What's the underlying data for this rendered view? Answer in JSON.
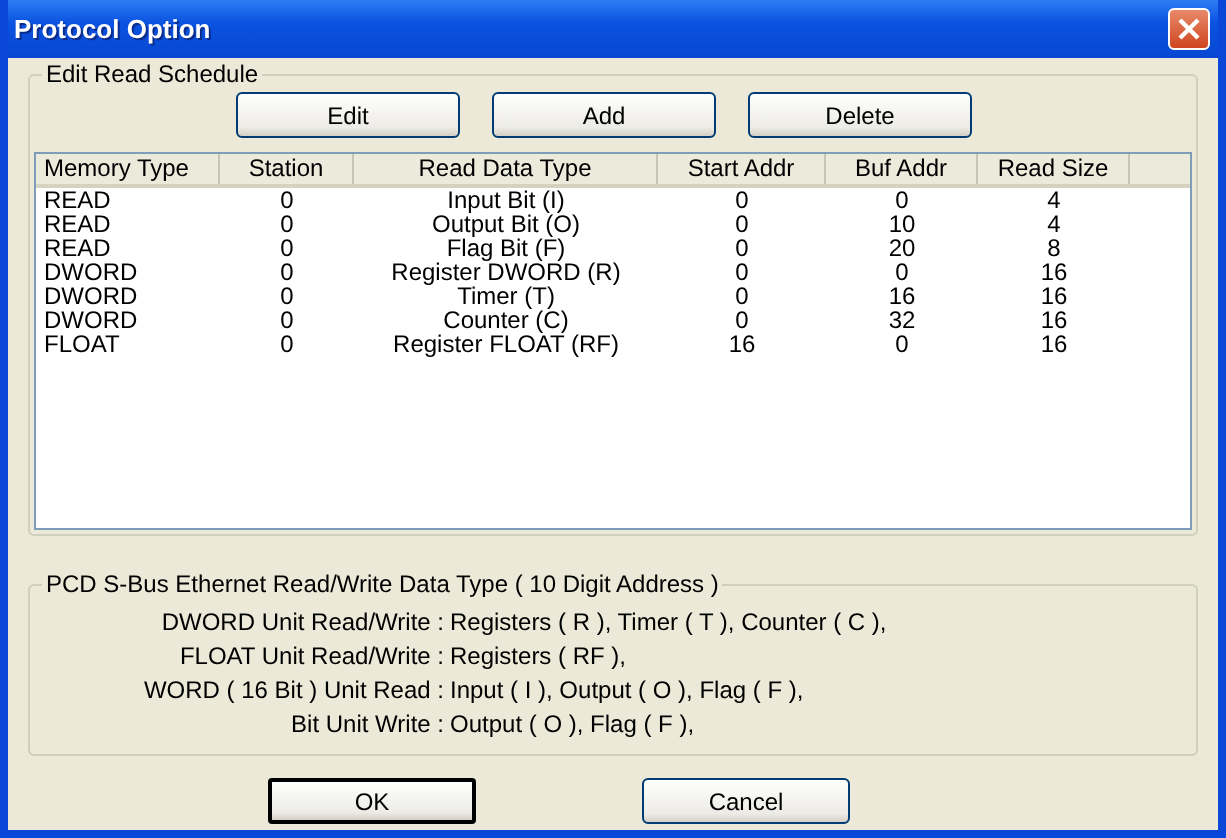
{
  "window": {
    "title": "Protocol Option"
  },
  "schedule": {
    "legend": "Edit Read Schedule",
    "buttons": [
      "Edit",
      "Add",
      "Delete"
    ],
    "table": {
      "columns": [
        "Memory Type",
        "Station",
        "Read Data Type",
        "Start Addr",
        "Buf Addr",
        "Read Size"
      ],
      "rows": [
        [
          "READ",
          "0",
          "Input Bit (I)",
          "0",
          "0",
          "4"
        ],
        [
          "READ",
          "0",
          "Output Bit (O)",
          "0",
          "10",
          "4"
        ],
        [
          "READ",
          "0",
          "Flag Bit (F)",
          "0",
          "20",
          "8"
        ],
        [
          "DWORD",
          "0",
          "Register DWORD (R)",
          "0",
          "0",
          "16"
        ],
        [
          "DWORD",
          "0",
          "Timer (T)",
          "0",
          "16",
          "16"
        ],
        [
          "DWORD",
          "0",
          "Counter (C)",
          "0",
          "32",
          "16"
        ],
        [
          "FLOAT",
          "0",
          "Register FLOAT (RF)",
          "16",
          "0",
          "16"
        ]
      ]
    }
  },
  "info": {
    "legend": "PCD S-Bus Ethernet Read/Write Data Type ( 10 Digit Address )",
    "lines": [
      {
        "label": "DWORD Unit Read/Write :",
        "value": "Registers ( R ), Timer ( T ), Counter ( C ),"
      },
      {
        "label": "FLOAT Unit Read/Write :",
        "value": "Registers ( RF ),"
      },
      {
        "label": "WORD ( 16 Bit ) Unit Read :",
        "value": "Input ( I ), Output ( O ), Flag ( F ),"
      },
      {
        "label": "Bit Unit Write :",
        "value": "Output ( O ), Flag ( F ),"
      }
    ]
  },
  "dialog_buttons": [
    {
      "label": "OK",
      "default": true
    },
    {
      "label": "Cancel",
      "default": false
    }
  ]
}
